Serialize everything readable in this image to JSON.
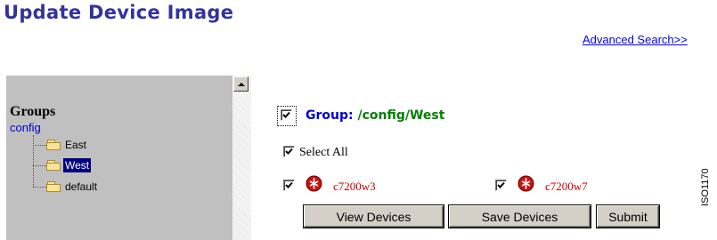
{
  "page": {
    "title": "Update Device Image"
  },
  "header": {
    "advanced_search_link": "Advanced Search>>"
  },
  "groups_panel": {
    "title": "Groups",
    "root_label": "config",
    "items": [
      {
        "label": "East",
        "icon": "folder-icon",
        "selected": false
      },
      {
        "label": "West",
        "icon": "folder-icon",
        "selected": true
      },
      {
        "label": "default",
        "icon": "folder-icon",
        "selected": false
      }
    ]
  },
  "group_header": {
    "prefix": "Group:",
    "path": "/config/West",
    "checked": true
  },
  "select_all": {
    "label": "Select All",
    "checked": true
  },
  "devices": [
    {
      "name": "c7200w3",
      "icon": "router-icon",
      "checked": true
    },
    {
      "name": "c7200w7",
      "icon": "router-icon",
      "checked": true
    }
  ],
  "buttons": {
    "view_devices": "View Devices",
    "save_devices": "Save Devices",
    "submit": "Submit"
  },
  "figure_id": "ISO1170",
  "colors": {
    "title": "#333399",
    "group_label": "#0000cc",
    "group_path": "#008000",
    "device_name": "#cc0000",
    "panel_bg": "#c0c0c0"
  }
}
